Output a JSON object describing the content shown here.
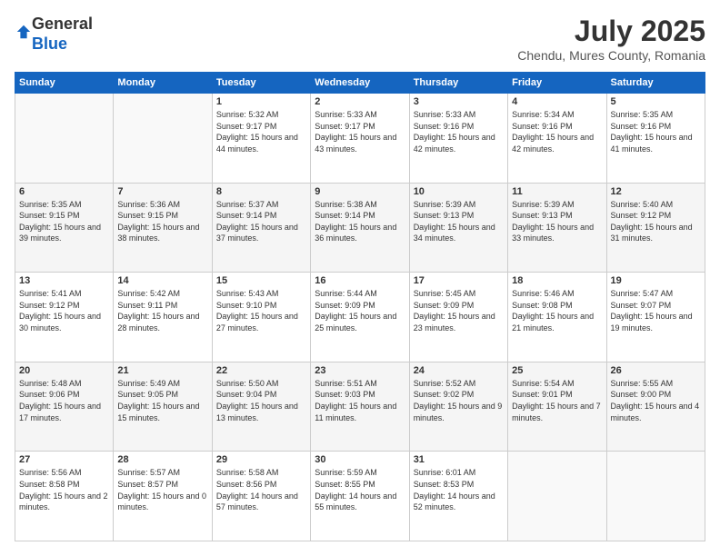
{
  "logo": {
    "general": "General",
    "blue": "Blue"
  },
  "title": "July 2025",
  "subtitle": "Chendu, Mures County, Romania",
  "header_days": [
    "Sunday",
    "Monday",
    "Tuesday",
    "Wednesday",
    "Thursday",
    "Friday",
    "Saturday"
  ],
  "weeks": [
    [
      {
        "day": "",
        "sunrise": "",
        "sunset": "",
        "daylight": ""
      },
      {
        "day": "",
        "sunrise": "",
        "sunset": "",
        "daylight": ""
      },
      {
        "day": "1",
        "sunrise": "Sunrise: 5:32 AM",
        "sunset": "Sunset: 9:17 PM",
        "daylight": "Daylight: 15 hours and 44 minutes."
      },
      {
        "day": "2",
        "sunrise": "Sunrise: 5:33 AM",
        "sunset": "Sunset: 9:17 PM",
        "daylight": "Daylight: 15 hours and 43 minutes."
      },
      {
        "day": "3",
        "sunrise": "Sunrise: 5:33 AM",
        "sunset": "Sunset: 9:16 PM",
        "daylight": "Daylight: 15 hours and 42 minutes."
      },
      {
        "day": "4",
        "sunrise": "Sunrise: 5:34 AM",
        "sunset": "Sunset: 9:16 PM",
        "daylight": "Daylight: 15 hours and 42 minutes."
      },
      {
        "day": "5",
        "sunrise": "Sunrise: 5:35 AM",
        "sunset": "Sunset: 9:16 PM",
        "daylight": "Daylight: 15 hours and 41 minutes."
      }
    ],
    [
      {
        "day": "6",
        "sunrise": "Sunrise: 5:35 AM",
        "sunset": "Sunset: 9:15 PM",
        "daylight": "Daylight: 15 hours and 39 minutes."
      },
      {
        "day": "7",
        "sunrise": "Sunrise: 5:36 AM",
        "sunset": "Sunset: 9:15 PM",
        "daylight": "Daylight: 15 hours and 38 minutes."
      },
      {
        "day": "8",
        "sunrise": "Sunrise: 5:37 AM",
        "sunset": "Sunset: 9:14 PM",
        "daylight": "Daylight: 15 hours and 37 minutes."
      },
      {
        "day": "9",
        "sunrise": "Sunrise: 5:38 AM",
        "sunset": "Sunset: 9:14 PM",
        "daylight": "Daylight: 15 hours and 36 minutes."
      },
      {
        "day": "10",
        "sunrise": "Sunrise: 5:39 AM",
        "sunset": "Sunset: 9:13 PM",
        "daylight": "Daylight: 15 hours and 34 minutes."
      },
      {
        "day": "11",
        "sunrise": "Sunrise: 5:39 AM",
        "sunset": "Sunset: 9:13 PM",
        "daylight": "Daylight: 15 hours and 33 minutes."
      },
      {
        "day": "12",
        "sunrise": "Sunrise: 5:40 AM",
        "sunset": "Sunset: 9:12 PM",
        "daylight": "Daylight: 15 hours and 31 minutes."
      }
    ],
    [
      {
        "day": "13",
        "sunrise": "Sunrise: 5:41 AM",
        "sunset": "Sunset: 9:12 PM",
        "daylight": "Daylight: 15 hours and 30 minutes."
      },
      {
        "day": "14",
        "sunrise": "Sunrise: 5:42 AM",
        "sunset": "Sunset: 9:11 PM",
        "daylight": "Daylight: 15 hours and 28 minutes."
      },
      {
        "day": "15",
        "sunrise": "Sunrise: 5:43 AM",
        "sunset": "Sunset: 9:10 PM",
        "daylight": "Daylight: 15 hours and 27 minutes."
      },
      {
        "day": "16",
        "sunrise": "Sunrise: 5:44 AM",
        "sunset": "Sunset: 9:09 PM",
        "daylight": "Daylight: 15 hours and 25 minutes."
      },
      {
        "day": "17",
        "sunrise": "Sunrise: 5:45 AM",
        "sunset": "Sunset: 9:09 PM",
        "daylight": "Daylight: 15 hours and 23 minutes."
      },
      {
        "day": "18",
        "sunrise": "Sunrise: 5:46 AM",
        "sunset": "Sunset: 9:08 PM",
        "daylight": "Daylight: 15 hours and 21 minutes."
      },
      {
        "day": "19",
        "sunrise": "Sunrise: 5:47 AM",
        "sunset": "Sunset: 9:07 PM",
        "daylight": "Daylight: 15 hours and 19 minutes."
      }
    ],
    [
      {
        "day": "20",
        "sunrise": "Sunrise: 5:48 AM",
        "sunset": "Sunset: 9:06 PM",
        "daylight": "Daylight: 15 hours and 17 minutes."
      },
      {
        "day": "21",
        "sunrise": "Sunrise: 5:49 AM",
        "sunset": "Sunset: 9:05 PM",
        "daylight": "Daylight: 15 hours and 15 minutes."
      },
      {
        "day": "22",
        "sunrise": "Sunrise: 5:50 AM",
        "sunset": "Sunset: 9:04 PM",
        "daylight": "Daylight: 15 hours and 13 minutes."
      },
      {
        "day": "23",
        "sunrise": "Sunrise: 5:51 AM",
        "sunset": "Sunset: 9:03 PM",
        "daylight": "Daylight: 15 hours and 11 minutes."
      },
      {
        "day": "24",
        "sunrise": "Sunrise: 5:52 AM",
        "sunset": "Sunset: 9:02 PM",
        "daylight": "Daylight: 15 hours and 9 minutes."
      },
      {
        "day": "25",
        "sunrise": "Sunrise: 5:54 AM",
        "sunset": "Sunset: 9:01 PM",
        "daylight": "Daylight: 15 hours and 7 minutes."
      },
      {
        "day": "26",
        "sunrise": "Sunrise: 5:55 AM",
        "sunset": "Sunset: 9:00 PM",
        "daylight": "Daylight: 15 hours and 4 minutes."
      }
    ],
    [
      {
        "day": "27",
        "sunrise": "Sunrise: 5:56 AM",
        "sunset": "Sunset: 8:58 PM",
        "daylight": "Daylight: 15 hours and 2 minutes."
      },
      {
        "day": "28",
        "sunrise": "Sunrise: 5:57 AM",
        "sunset": "Sunset: 8:57 PM",
        "daylight": "Daylight: 15 hours and 0 minutes."
      },
      {
        "day": "29",
        "sunrise": "Sunrise: 5:58 AM",
        "sunset": "Sunset: 8:56 PM",
        "daylight": "Daylight: 14 hours and 57 minutes."
      },
      {
        "day": "30",
        "sunrise": "Sunrise: 5:59 AM",
        "sunset": "Sunset: 8:55 PM",
        "daylight": "Daylight: 14 hours and 55 minutes."
      },
      {
        "day": "31",
        "sunrise": "Sunrise: 6:01 AM",
        "sunset": "Sunset: 8:53 PM",
        "daylight": "Daylight: 14 hours and 52 minutes."
      },
      {
        "day": "",
        "sunrise": "",
        "sunset": "",
        "daylight": ""
      },
      {
        "day": "",
        "sunrise": "",
        "sunset": "",
        "daylight": ""
      }
    ]
  ]
}
